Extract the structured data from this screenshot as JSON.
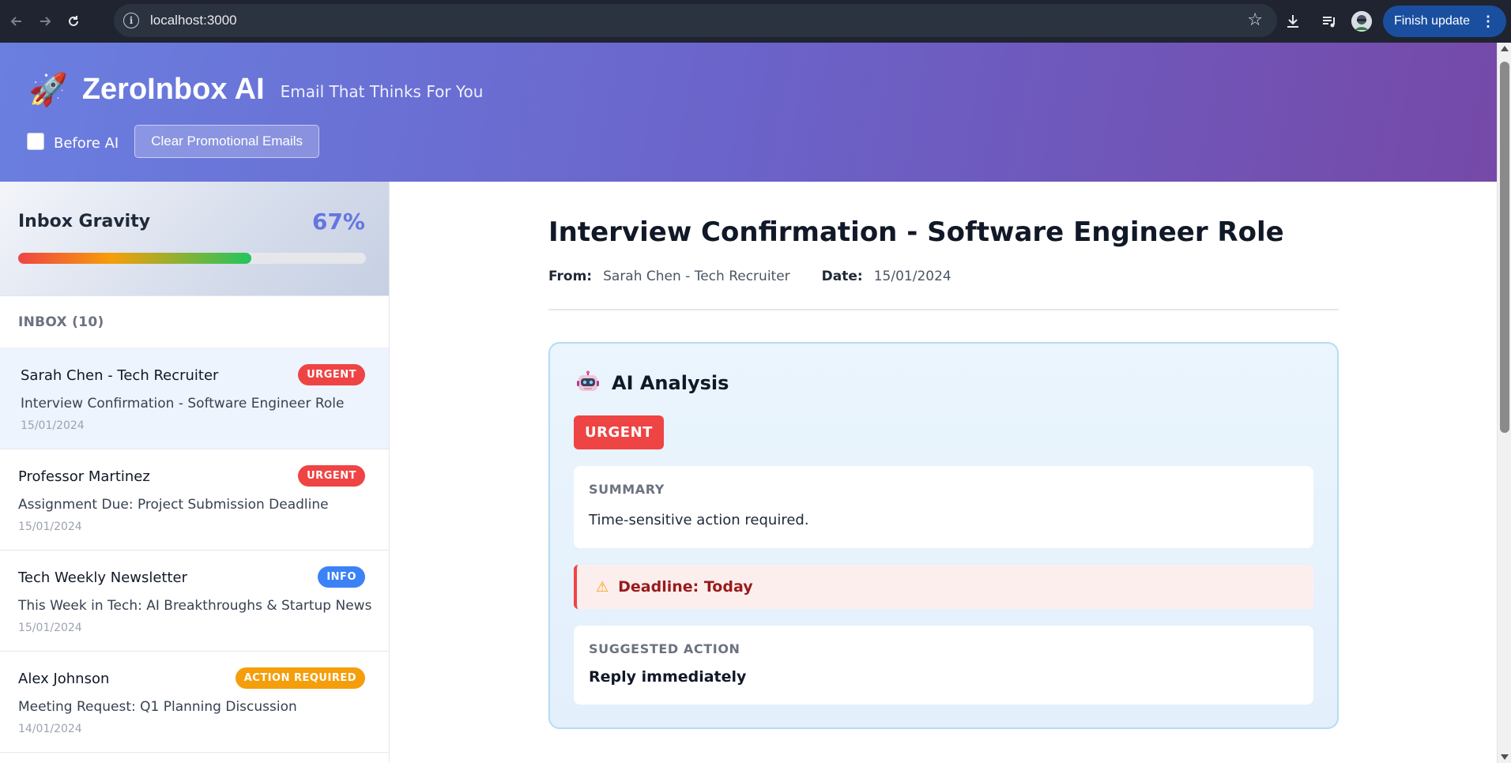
{
  "browser": {
    "url": "localhost:3000",
    "finish_update_label": "Finish update",
    "icons": [
      "back-icon",
      "forward-icon",
      "reload-icon",
      "info-icon",
      "star-icon",
      "download-icon",
      "media-icon",
      "profile-avatar",
      "kebab-icon"
    ]
  },
  "header": {
    "title": "ZeroInbox AI",
    "tagline": "Email That Thinks For You",
    "logo_icon": "rocket-icon",
    "before_ai_label": "Before AI",
    "before_ai_checked": false,
    "clear_button_label": "Clear Promotional Emails"
  },
  "gravity": {
    "title": "Inbox Gravity",
    "percent_label": "67%",
    "value": 0.67
  },
  "inbox": {
    "label": "INBOX (10)",
    "emails": [
      {
        "sender": "Sarah Chen - Tech Recruiter",
        "subject": "Interview Confirmation - Software Engineer Role",
        "date": "15/01/2024",
        "badge": "URGENT",
        "badge_color": "#ef4444",
        "selected": true
      },
      {
        "sender": "Professor Martinez",
        "subject": "Assignment Due: Project Submission Deadline",
        "date": "15/01/2024",
        "badge": "URGENT",
        "badge_color": "#ef4444",
        "selected": false
      },
      {
        "sender": "Tech Weekly Newsletter",
        "subject": "This Week in Tech: AI Breakthroughs & Startup News",
        "date": "15/01/2024",
        "badge": "INFO",
        "badge_color": "#3b82f6",
        "selected": false
      },
      {
        "sender": "Alex Johnson",
        "subject": "Meeting Request: Q1 Planning Discussion",
        "date": "14/01/2024",
        "badge": "ACTION REQUIRED",
        "badge_color": "#f59e0b",
        "selected": false
      }
    ]
  },
  "detail": {
    "subject": "Interview Confirmation - Software Engineer Role",
    "from_label": "From:",
    "from": "Sarah Chen - Tech Recruiter",
    "date_label": "Date:",
    "date": "15/01/2024",
    "analysis": {
      "title": "AI Analysis",
      "icon": "robot-icon",
      "priority": "URGENT",
      "priority_color": "#ef4444",
      "summary_label": "SUMMARY",
      "summary": "Time-sensitive action required.",
      "deadline_icon": "warning-icon",
      "deadline": "Deadline: Today",
      "action_label": "SUGGESTED ACTION",
      "action": "Reply immediately"
    }
  },
  "colors": {
    "accent": "#6476e0",
    "header_start": "#6a7fe0",
    "header_end": "#7549a8"
  }
}
